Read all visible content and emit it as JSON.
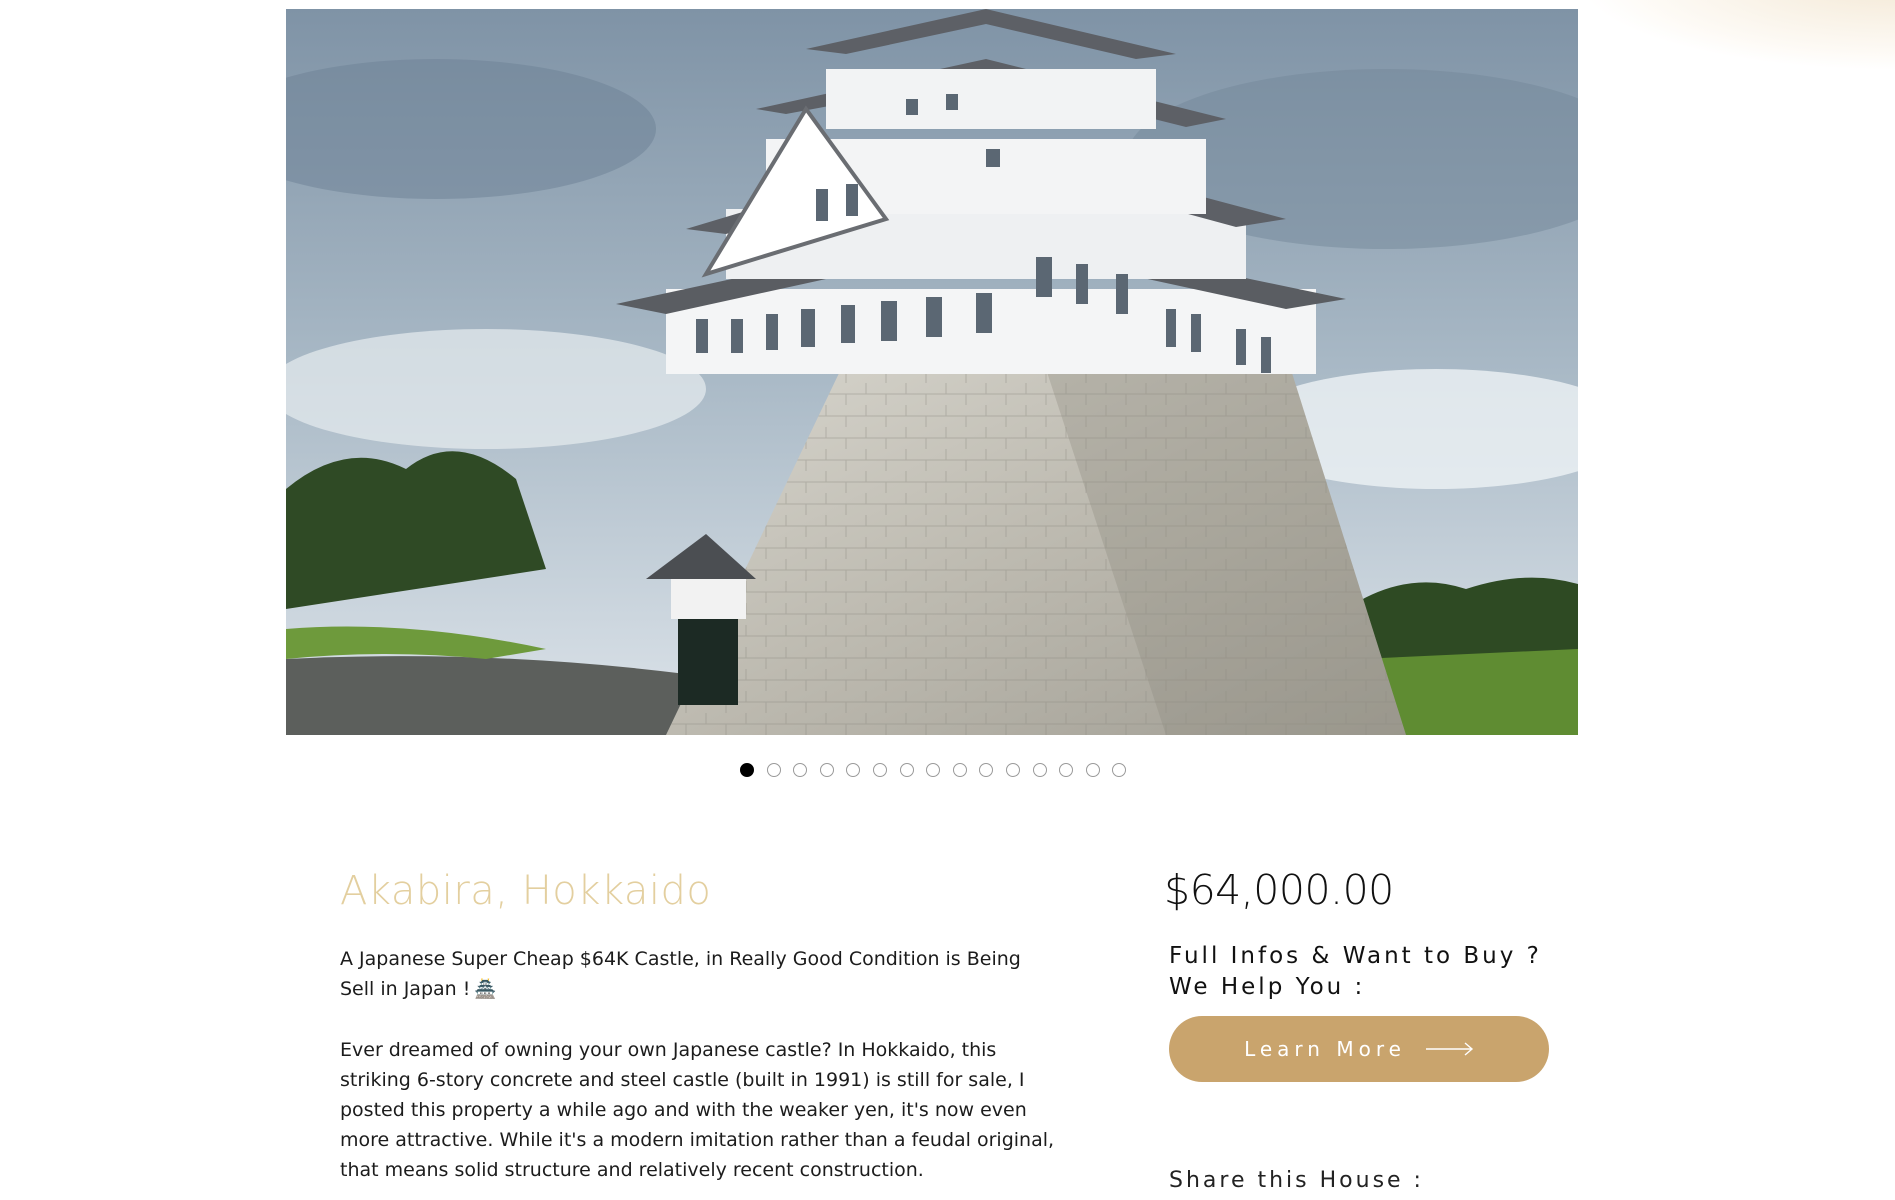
{
  "gallery": {
    "image_alt": "Japanese castle on stone base in Akabira",
    "slide_count": 15,
    "active_slide": 1
  },
  "listing": {
    "title": "Akabira, Hokkaido",
    "intro": "A Japanese Super Cheap $64K Castle, in Really Good Condition is Being Sell in Japan !",
    "intro_icon": "castle-emoji-icon",
    "body": "Ever dreamed of owning your own Japanese castle?  In Hokkaido, this striking 6-story concrete and steel castle (built in 1991) is still for sale, I posted this property a while ago and with the weaker yen, it's now even more attractive. While it's a modern imitation rather than a feudal original, that means solid structure and relatively recent construction."
  },
  "sidebar": {
    "price": "$64,000.00",
    "cta_heading": "Full Infos & Want to Buy ?\nWe Help You :",
    "cta_line1": "Full Infos & Want to Buy ?",
    "cta_line2": "We Help You :",
    "button_label": "Learn More",
    "share_label": "Share this House :"
  },
  "colors": {
    "title": "#e3cf9f",
    "button": "#c9a46d",
    "active_dot": "#000000"
  }
}
